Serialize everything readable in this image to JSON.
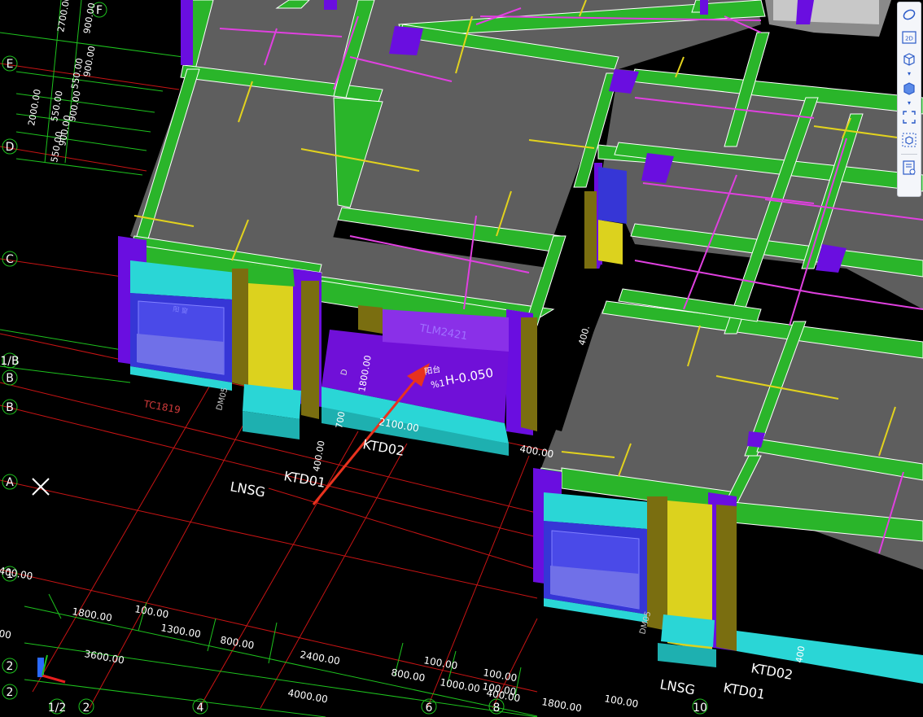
{
  "viewport": {
    "axis_labels_left": [
      "F",
      "E",
      "D",
      "C",
      "1/B",
      "B",
      "B",
      "A",
      "1",
      "2",
      "2"
    ],
    "axis_labels_bottom": [
      "1/2",
      "2",
      "4",
      "6",
      "8",
      "10"
    ],
    "dim_left": [
      "2700.00",
      "900.00",
      "900.00",
      "550.00",
      "900.00",
      "550.00",
      "2000.00",
      "900.00",
      "550.00"
    ],
    "dim_bottom": [
      "1800.00",
      "100.00",
      "1300.00",
      "3600.00",
      "800.00",
      "2400.00",
      "100.00",
      "800.00",
      "100.00",
      "1000.00",
      "100.00",
      "400.00",
      "4000.00",
      "1800.00",
      "100.00",
      "400.00",
      "00"
    ],
    "model_labels": {
      "lnsg_1": "LNSG",
      "ktd01_1": "KTD01",
      "ktd02_1": "KTD02",
      "tc1819": "TC1819",
      "tlm2421": "TLM2421",
      "dim_400_a": "400.00",
      "dim_400_b": "400.00",
      "dim_400_c": "400.",
      "dim_700": "700",
      "dim_1800": "1800.00",
      "dim_2100": "2100.00",
      "elevation": "H-0.050",
      "balcony_1": "阳台",
      "balcony_2": "%1",
      "lnsg_2": "LNSG",
      "ktd01_2": "KTD01",
      "ktd02_2": "KTD02",
      "dim_400_d": "400",
      "dim_dm_1": "DM05",
      "dim_dm_2": "DM05",
      "d_mark": "D",
      "window_note": "阳 窗"
    }
  },
  "toolbar": {
    "items": [
      {
        "name": "orbit-icon"
      },
      {
        "name": "view-2d-icon",
        "label": "2D"
      },
      {
        "name": "view-3d-box-icon"
      },
      {
        "name": "view-3d-solid-icon"
      },
      {
        "name": "fullscreen-icon"
      },
      {
        "name": "component-view-icon"
      },
      {
        "name": "properties-panel-icon"
      }
    ]
  },
  "colors": {
    "background": "#000000",
    "wall": "#2ab52a",
    "column": "#6a0ee0",
    "floor": "#5e5e5e",
    "grid_red": "#d01414",
    "grid_green": "#1ec21e",
    "window_cyan": "#2ad6d6",
    "door_yellow": "#e2d21e",
    "beam_magenta": "#e040e0",
    "annotation_arrow": "#e8321e"
  }
}
